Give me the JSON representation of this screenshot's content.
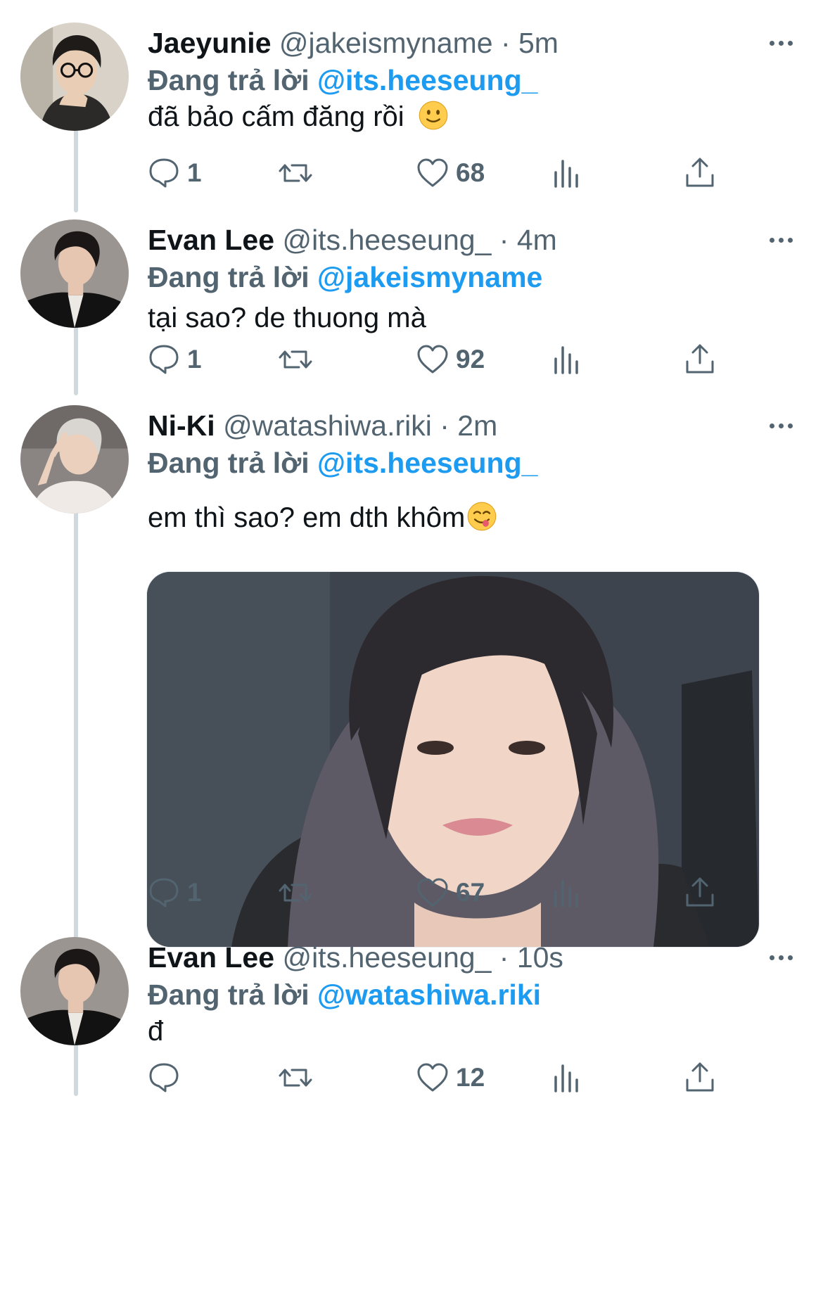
{
  "reply_prefix": "Đang trả lời",
  "colors": {
    "accent": "#1d9bf0",
    "secondary": "#536471",
    "text": "#0f1419",
    "thread": "#cfd9de"
  },
  "tweets": [
    {
      "display_name": "Jaeyunie",
      "handle": "@jakeismyname",
      "time": "5m",
      "meta": "@jakeismyname · 5m",
      "reply_to": "@its.heeseung_",
      "text": "đã bảo cấm đăng rồi",
      "emoji": "slightly-smiling-face",
      "reply_count": "1",
      "retweet_count": "",
      "like_count": "68"
    },
    {
      "display_name": "Evan Lee",
      "handle": "@its.heeseung_",
      "time": "4m",
      "meta": "@its.heeseung_ · 4m",
      "reply_to": "@jakeismyname",
      "text": "tại sao? de thuong mà",
      "reply_count": "1",
      "retweet_count": "",
      "like_count": "92"
    },
    {
      "display_name": "Ni-Ki",
      "handle": "@watashiwa.riki",
      "time": "2m",
      "meta": "@watashiwa.riki · 2m",
      "reply_to": "@its.heeseung_",
      "text": "em thì sao? em dth khôm",
      "emoji": "face-savoring-food",
      "has_media": true,
      "reply_count": "1",
      "retweet_count": "",
      "like_count": "67"
    },
    {
      "display_name": "Evan Lee",
      "handle": "@its.heeseung_",
      "time": "10s",
      "meta": "@its.heeseung_ · 10s",
      "reply_to": "@watashiwa.riki",
      "text": "đ",
      "reply_count": "",
      "retweet_count": "",
      "like_count": "12"
    }
  ],
  "icons": {
    "reply": "speech-bubble-icon",
    "retweet": "retweet-arrows-icon",
    "like": "heart-icon",
    "views": "bar-chart-icon",
    "share": "upload-arrow-icon",
    "more": "ellipsis-icon"
  }
}
